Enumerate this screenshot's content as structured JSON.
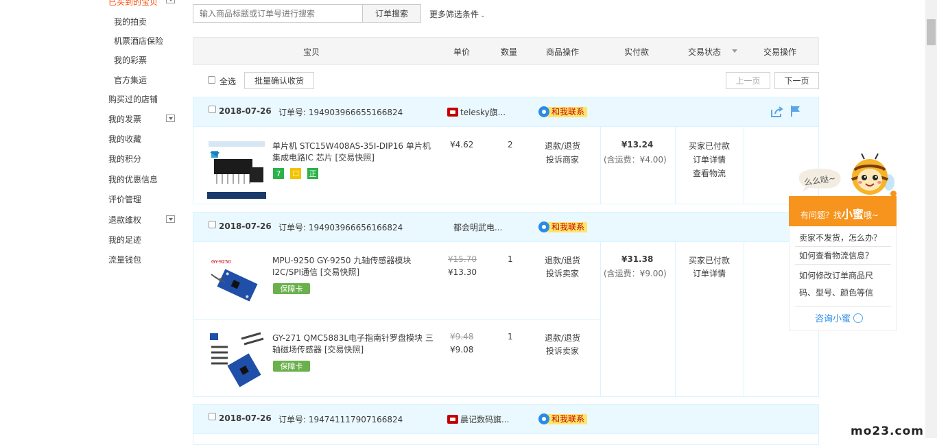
{
  "sidebar": {
    "top_cut": "已买到的宝贝",
    "sub_items": [
      "我的拍卖",
      "机票酒店保险",
      "我的彩票",
      "官方集运"
    ],
    "main_items": [
      "购买过的店铺",
      "我的发票",
      "我的收藏",
      "我的积分",
      "我的优惠信息",
      "评价管理",
      "退款维权",
      "我的足迹",
      "流量钱包"
    ]
  },
  "search": {
    "placeholder": "输入商品标题或订单号进行搜索",
    "button": "订单搜索",
    "more_filters": "更多筛选条件"
  },
  "table_header": {
    "item": "宝贝",
    "price": "单价",
    "qty": "数量",
    "ops": "商品操作",
    "paid": "实付款",
    "status": "交易状态",
    "action": "交易操作"
  },
  "toolbar": {
    "select_all": "全选",
    "batch_confirm": "批量确认收货",
    "prev": "上一页",
    "next": "下一页"
  },
  "orders": [
    {
      "date": "2018-07-26",
      "order_no": "订单号: 194903966655166824",
      "shop": "telesky旗...",
      "contact": "和我联系",
      "items": [
        {
          "title": "单片机 STC15W408AS-35I-DIP16 单片机集成电路IC 芯片 [交易快照]",
          "price": "¥4.62",
          "qty": "2",
          "op1": "退款/退货",
          "op2": "投诉商家",
          "badges": [
            "7",
            "☐",
            "正"
          ]
        }
      ],
      "paid": "¥13.24",
      "shipping": "(含运费：¥4.00)",
      "status1": "买家已付款",
      "status2": "订单详情",
      "status3": "查看物流"
    },
    {
      "date": "2018-07-26",
      "order_no": "订单号: 194903966656166824",
      "shop": "都会明武电...",
      "contact": "和我联系",
      "items": [
        {
          "title": "MPU-9250 GY-9250 九轴传感器模块 I2C/SPI通信 [交易快照]",
          "old_price": "¥15.70",
          "price": "¥13.30",
          "qty": "1",
          "op1": "退款/退货",
          "op2": "投诉卖家",
          "badge": "保障卡",
          "img_label": "GY-9250"
        },
        {
          "title": "GY-271 QMC5883L电子指南针罗盘模块 三轴磁场传感器 [交易快照]",
          "old_price": "¥9.48",
          "price": "¥9.08",
          "qty": "1",
          "op1": "退款/退货",
          "op2": "投诉卖家",
          "badge": "保障卡"
        }
      ],
      "paid": "¥31.38",
      "shipping": "(含运费：¥9.00)",
      "status1": "买家已付款",
      "status2": "订单详情"
    },
    {
      "date": "2018-07-26",
      "order_no": "订单号: 194741117907166824",
      "shop": "晨记数码旗...",
      "contact": "和我联系"
    }
  ],
  "assistant": {
    "bubble": "么么哒~",
    "title_pre": "有问题？找",
    "title_name": "小蜜",
    "title_post": "哦~",
    "questions": [
      "卖家不发货，怎么办？",
      "如何查看物流信息？",
      "如何修改订单商品尺码、型号、颜色等信"
    ],
    "consult": "咨询小蜜"
  },
  "watermark": "mo23.com",
  "colors": {
    "accent": "#f40",
    "blue": "#2a8ce8",
    "tmall_red": "#c40000",
    "assistant_orange": "#f7941d"
  }
}
